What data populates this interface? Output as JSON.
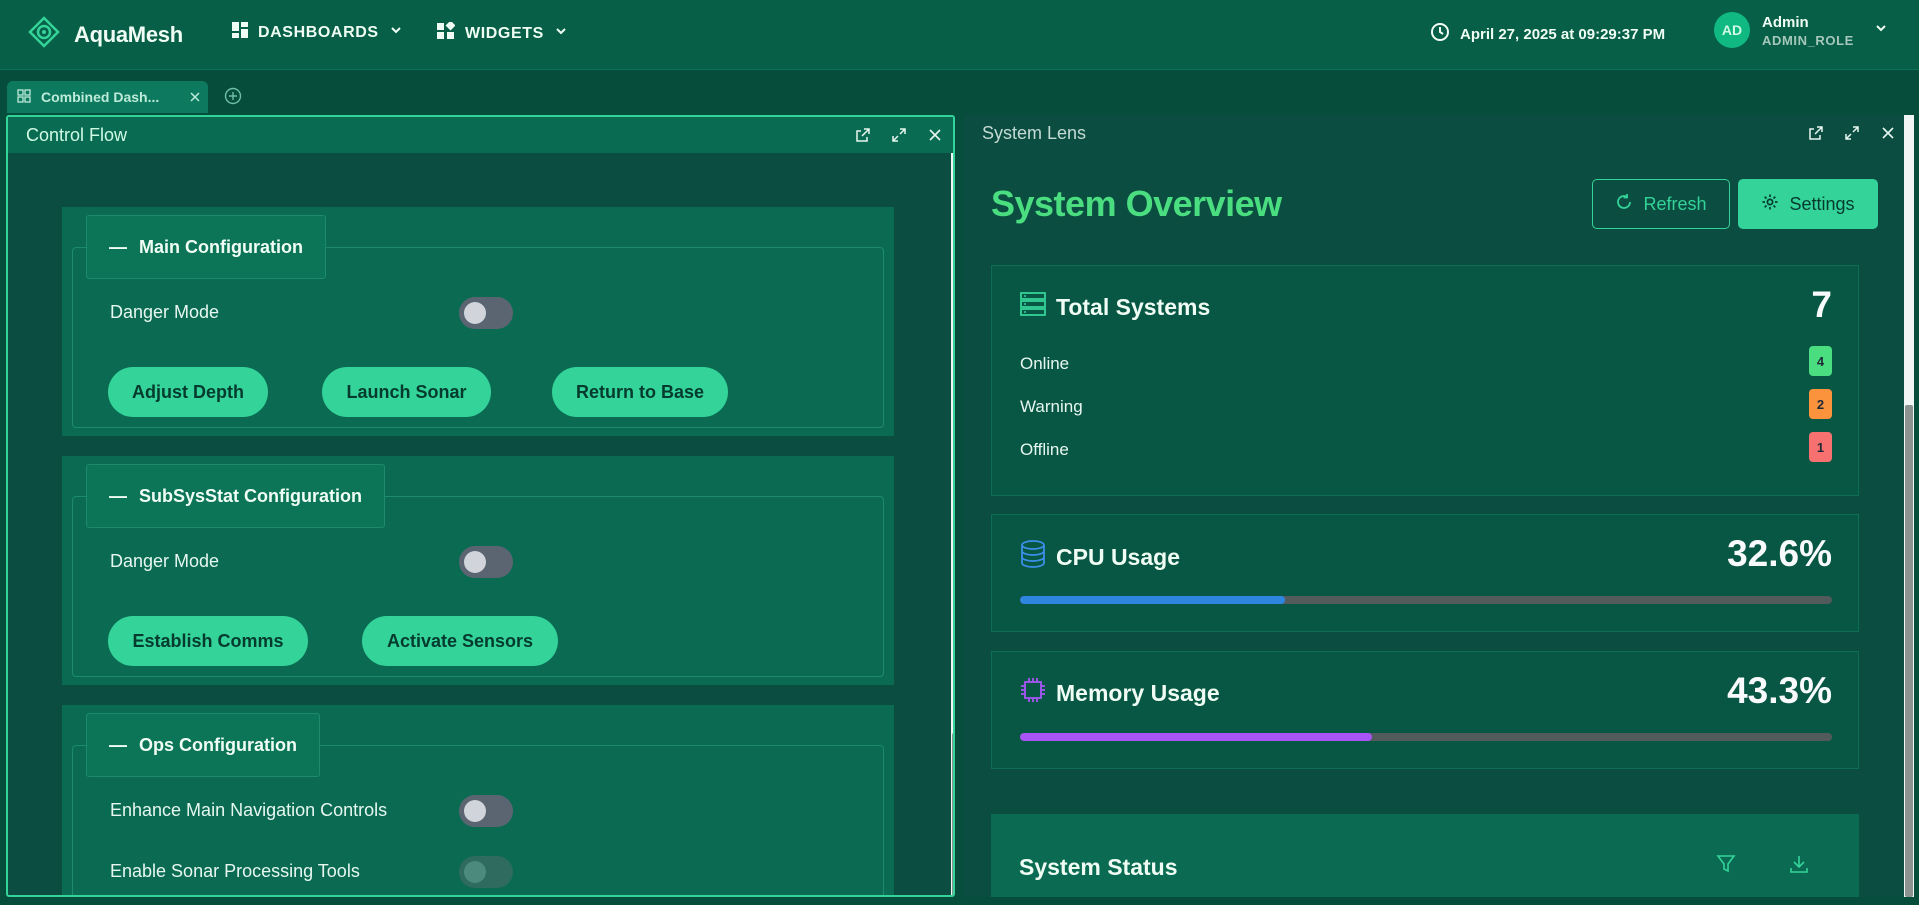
{
  "app": {
    "brand": "AquaMesh"
  },
  "nav": {
    "dashboards": "DASHBOARDS",
    "widgets": "WIDGETS"
  },
  "clock": {
    "text": "April 27, 2025 at 09:29:37 PM"
  },
  "user": {
    "initials": "AD",
    "name": "Admin",
    "role": "ADMIN_ROLE"
  },
  "tabs": [
    {
      "label": "Combined Dash..."
    }
  ],
  "left_panel": {
    "title": "Control Flow",
    "sections": [
      {
        "title": "Main Configuration",
        "rows": [
          {
            "label": "Danger Mode",
            "on": false
          }
        ],
        "buttons": [
          "Adjust Depth",
          "Launch Sonar",
          "Return to Base"
        ]
      },
      {
        "title": "SubSysStat Configuration",
        "rows": [
          {
            "label": "Danger Mode",
            "on": false
          }
        ],
        "buttons": [
          "Establish Comms",
          "Activate Sensors"
        ]
      },
      {
        "title": "Ops Configuration",
        "rows": [
          {
            "label": "Enhance Main Navigation Controls",
            "on": false
          },
          {
            "label": "Enable Sonar Processing Tools",
            "on": false,
            "disabled": true
          }
        ],
        "buttons": []
      }
    ]
  },
  "right_panel": {
    "title": "System Lens",
    "heading": "System Overview",
    "refresh_label": "Refresh",
    "settings_label": "Settings",
    "total": {
      "title": "Total Systems",
      "value": "7",
      "rows": [
        {
          "label": "Online",
          "count": "4",
          "color": "#4ade80"
        },
        {
          "label": "Warning",
          "count": "2",
          "color": "#fb923c"
        },
        {
          "label": "Offline",
          "count": "1",
          "color": "#f87171"
        }
      ]
    },
    "cpu": {
      "title": "CPU Usage",
      "value": "32.6%",
      "percent": 32.6,
      "color": "#2f86e0"
    },
    "memory": {
      "title": "Memory Usage",
      "value": "43.3%",
      "percent": 43.3,
      "color": "#a855f7"
    },
    "status": {
      "title": "System Status"
    }
  },
  "colors": {
    "accent": "#34d399",
    "background": "#064e3b"
  }
}
